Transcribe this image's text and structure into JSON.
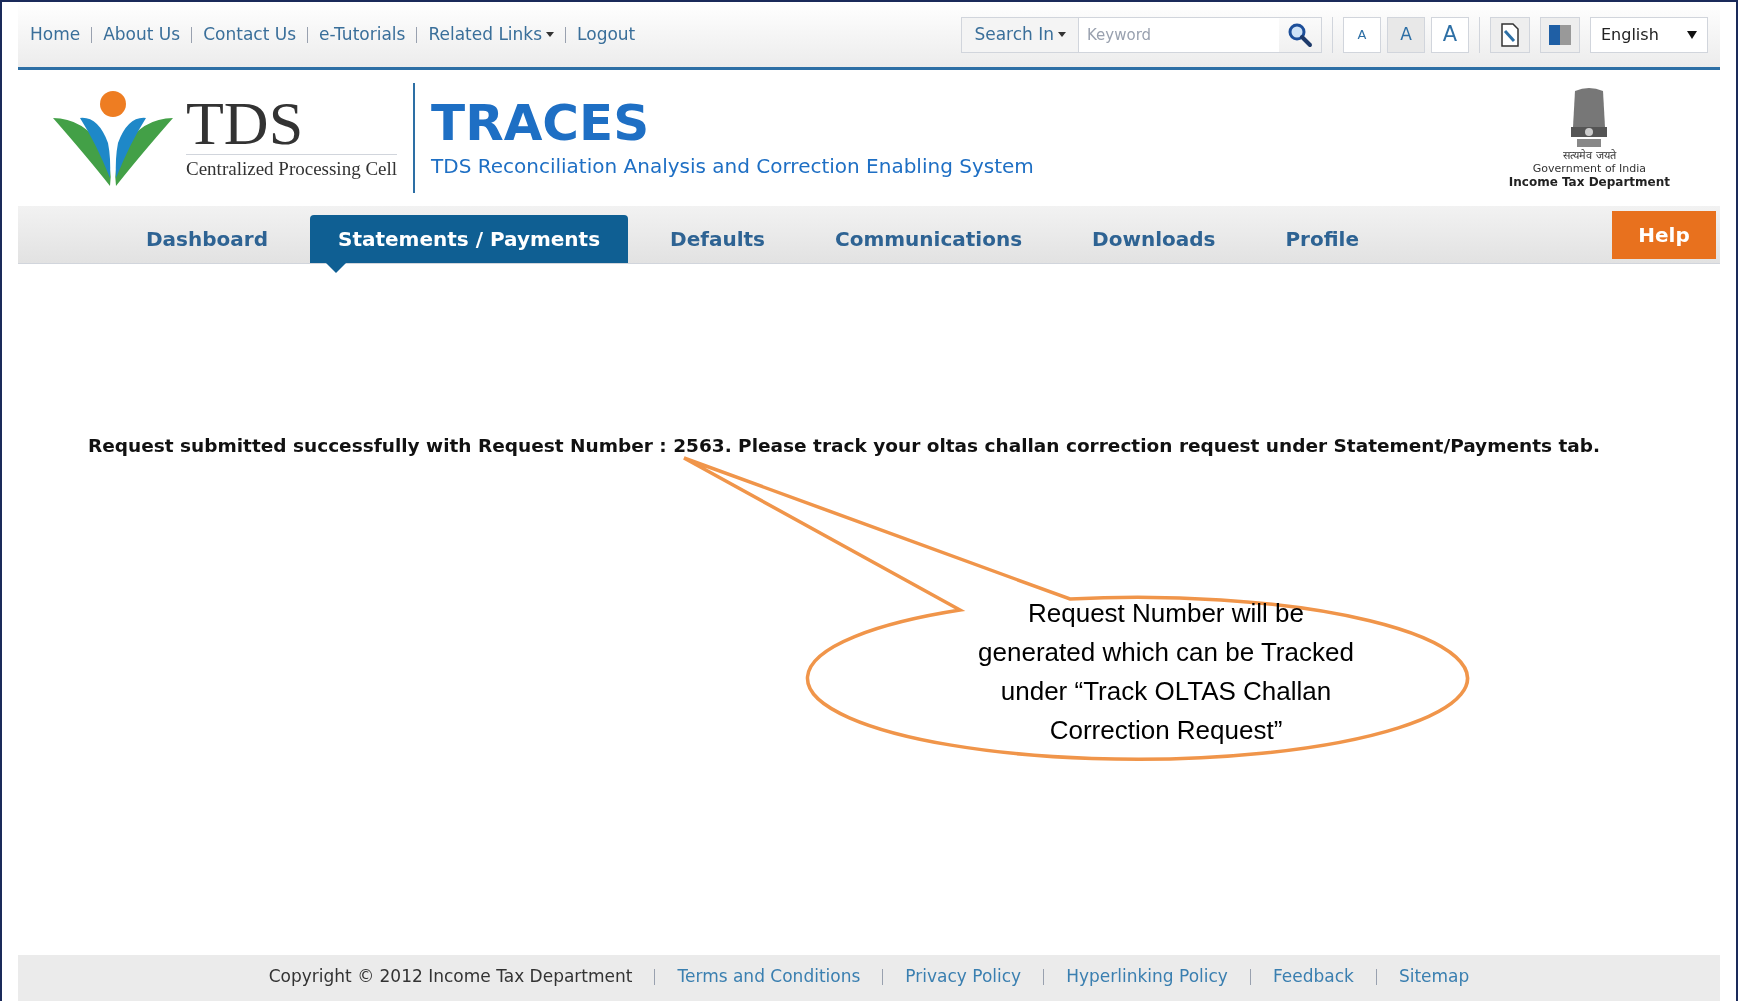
{
  "top_links": [
    {
      "label": "Home",
      "dropdown": false
    },
    {
      "label": "About Us",
      "dropdown": false
    },
    {
      "label": "Contact Us",
      "dropdown": false
    },
    {
      "label": "e-Tutorials",
      "dropdown": false
    },
    {
      "label": "Related Links",
      "dropdown": true
    },
    {
      "label": "Logout",
      "dropdown": false
    }
  ],
  "search": {
    "scope": "Search In",
    "placeholder": "Keyword"
  },
  "font_sizes": [
    "A",
    "A",
    "A"
  ],
  "language": "English",
  "logo": {
    "name": "TDS",
    "subtitle": "Centralized Processing Cell"
  },
  "brand": {
    "title": "TRACES",
    "subtitle": "TDS Reconciliation Analysis and Correction Enabling System"
  },
  "emblem": {
    "motto": "सत्यमेव जयते",
    "line1": "Government of India",
    "line2": "Income Tax Department"
  },
  "nav": [
    {
      "label": "Dashboard",
      "selected": false
    },
    {
      "label": "Statements / Payments",
      "selected": true
    },
    {
      "label": "Defaults",
      "selected": false
    },
    {
      "label": "Communications",
      "selected": false
    },
    {
      "label": "Downloads",
      "selected": false
    },
    {
      "label": "Profile",
      "selected": false
    }
  ],
  "help": "Help",
  "message": "Request submitted successfully with Request Number : 2563. Please track your oltas challan correction request under Statement/Payments tab.",
  "callout": "Request Number will be generated which can be Tracked under “Track OLTAS Challan Correction Request”",
  "footer": {
    "copyright": "Copyright © 2012 Income Tax Department",
    "links": [
      "Terms and Conditions",
      "Privacy Policy",
      "Hyperlinking Policy",
      "Feedback",
      "Sitemap"
    ]
  }
}
